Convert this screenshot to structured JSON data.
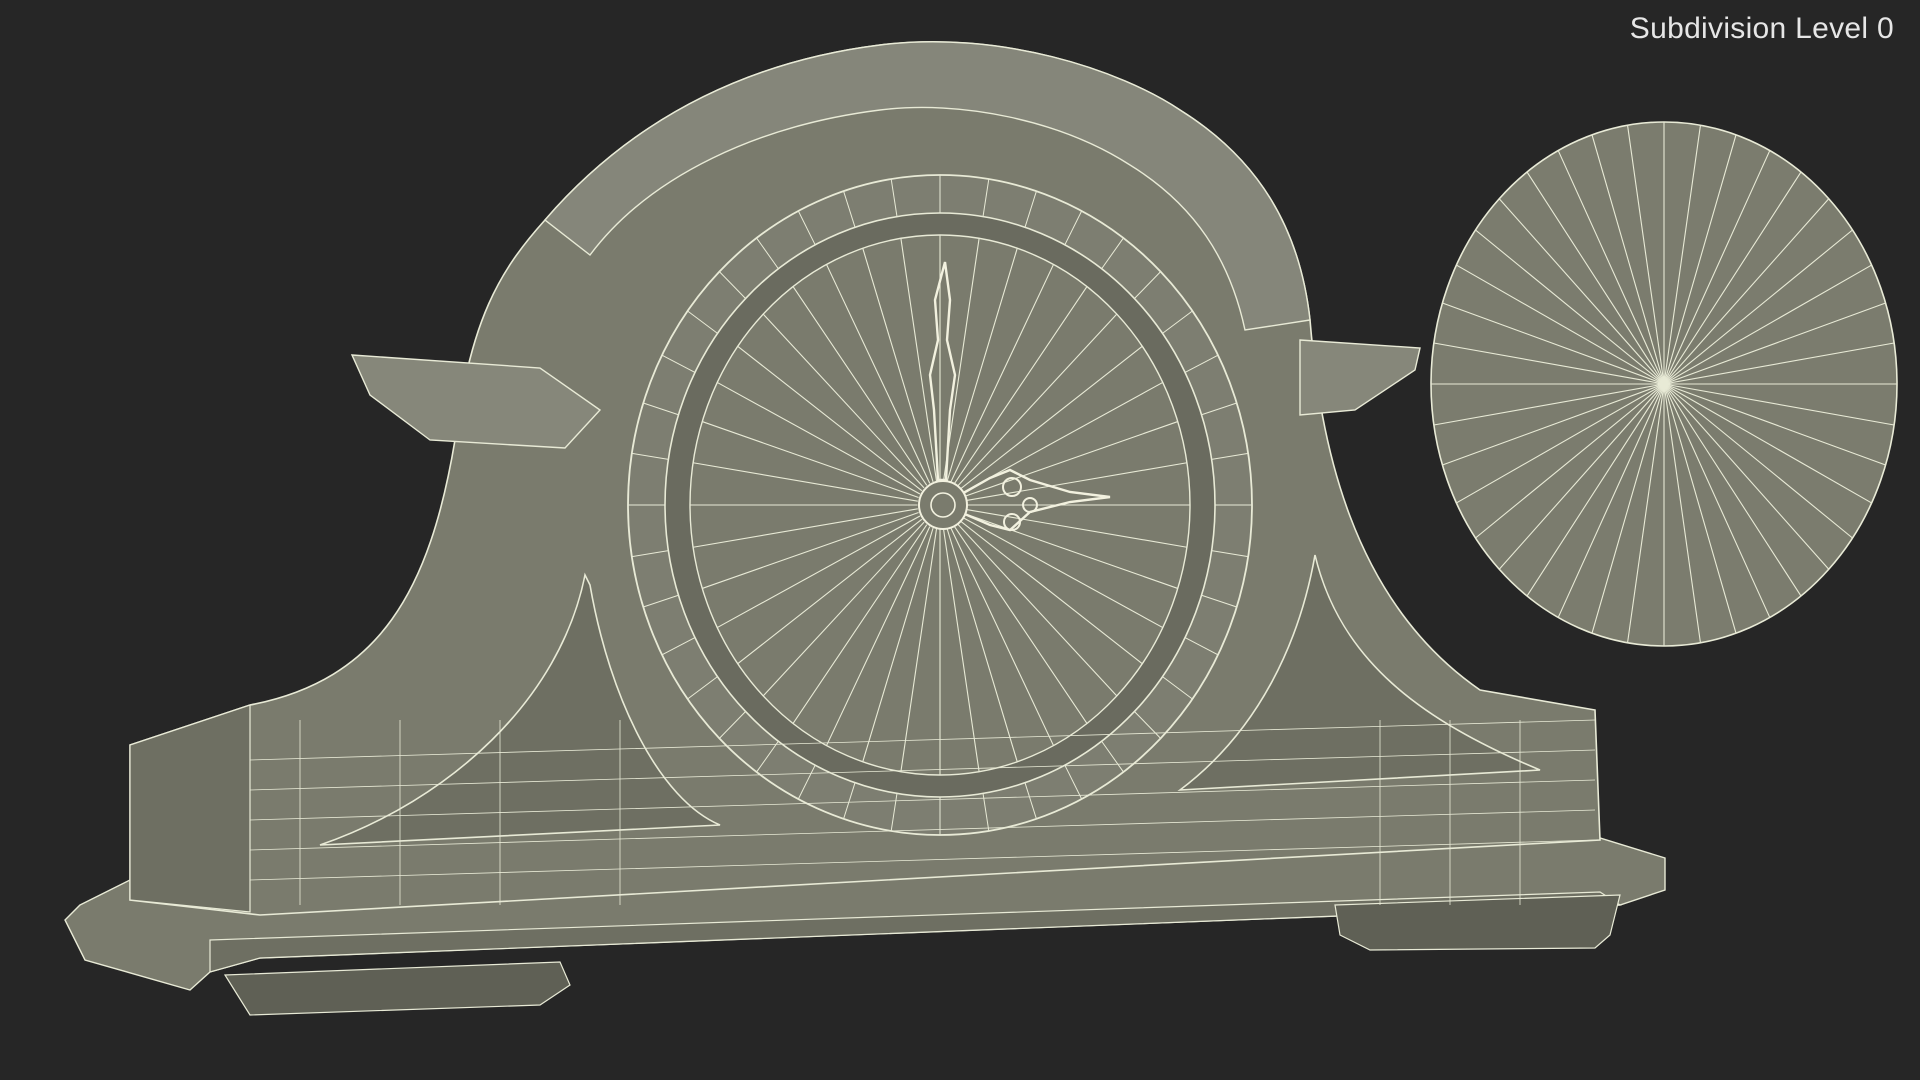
{
  "viewport": {
    "label": "Subdivision Level 0",
    "background": "#262626"
  },
  "colors": {
    "surface": "#7a7b6d",
    "surface_light": "#86877a",
    "surface_dark": "#5f6055",
    "wire": "#e8ead6",
    "hand": "#f2f1df"
  },
  "model": {
    "subject": "mantel-clock",
    "detached_part": "clock-face-disc"
  }
}
